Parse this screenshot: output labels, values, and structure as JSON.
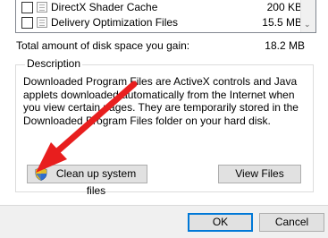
{
  "list": {
    "rows": [
      {
        "name": "DirectX Shader Cache",
        "size": "200 KB"
      },
      {
        "name": "Delivery Optimization Files",
        "size": "15.5 MB"
      }
    ]
  },
  "total": {
    "label": "Total amount of disk space you gain:",
    "value": "18.2 MB"
  },
  "description": {
    "title": "Description",
    "text": "Downloaded Program Files are ActiveX controls and Java applets downloaded automatically from the Internet when you view certain pages. They are temporarily stored in the Downloaded Program Files folder on your hard disk."
  },
  "buttons": {
    "cleanup": "Clean up system files",
    "view": "View Files",
    "ok": "OK",
    "cancel": "Cancel"
  },
  "icons": {
    "shield": "uac-shield-icon",
    "arrow": "red-arrow-annotation"
  },
  "colors": {
    "arrow": "#e81e1e",
    "ok_border": "#0078d7"
  }
}
